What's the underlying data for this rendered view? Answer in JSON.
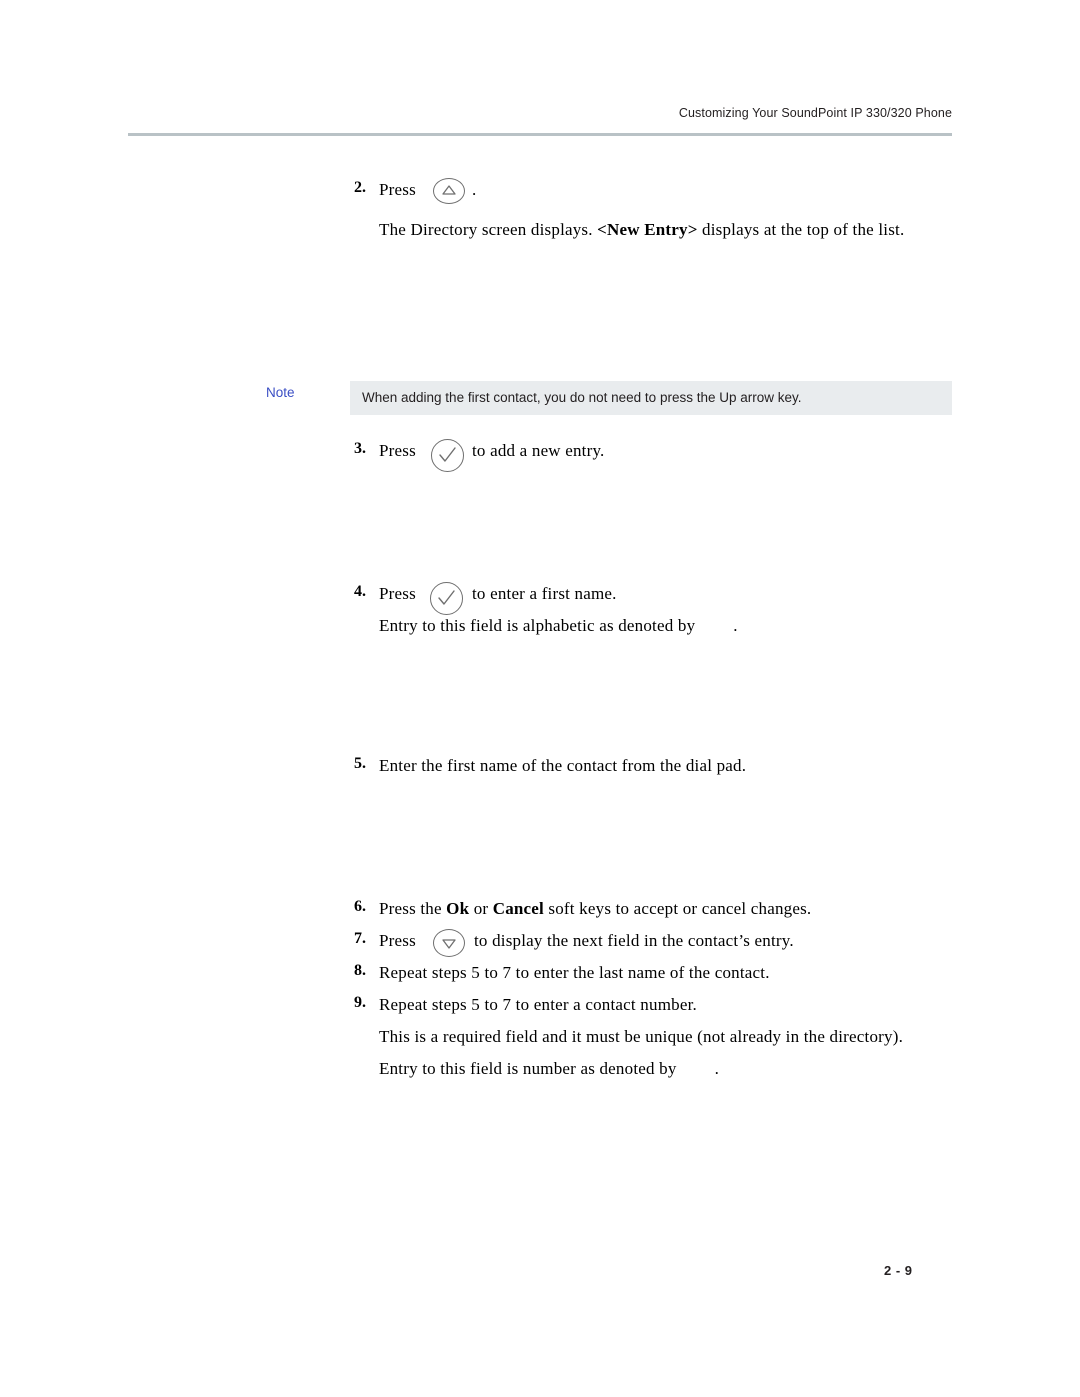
{
  "header": {
    "running_title": "Customizing Your SoundPoint IP 330/320 Phone"
  },
  "note": {
    "label": "Note",
    "text": "When adding the first contact, you do not need to press the Up arrow key."
  },
  "steps": {
    "s2_num": "2.",
    "s2_press": "Press",
    "s2_period": ".",
    "s2_result_a": "The Directory screen displays. ",
    "s2_result_b": "<New Entry>",
    "s2_result_c": " displays at the top of the list.",
    "s3_num": "3.",
    "s3_press": "Press",
    "s3_text": "to add a new entry.",
    "s4_num": "4.",
    "s4_press": "Press",
    "s4_text": "to enter a first name.",
    "s4_sub_a": "Entry to this field is alphabetic as denoted by",
    "s4_sub_b": ".",
    "s5_num": "5.",
    "s5_text": "Enter the first name of the contact from the dial pad.",
    "s6_num": "6.",
    "s6_a": "Press the ",
    "s6_ok": "Ok",
    "s6_b": " or ",
    "s6_cancel": "Cancel",
    "s6_c": " soft keys to accept or cancel changes.",
    "s7_num": "7.",
    "s7_press": "Press",
    "s7_text": "to display the next field in the contact’s entry.",
    "s8_num": "8.",
    "s8_text": "Repeat steps 5 to 7 to enter the last name of the contact.",
    "s9_num": "9.",
    "s9_text": "Repeat steps 5 to 7 to enter a contact number.",
    "s9_sub1": "This is a required field and it must be unique (not already in the directory).",
    "s9_sub2_a": "Entry to this field is number as denoted by",
    "s9_sub2_b": "."
  },
  "footer": {
    "page_number": "2 - 9"
  },
  "icons": {
    "up_arrow": "up-arrow-key-icon",
    "check": "check-key-icon",
    "down_arrow": "down-arrow-key-icon"
  },
  "colors": {
    "rule": "#b9c2c6",
    "note_bg": "#e9ecee",
    "note_label": "#3a4ec4",
    "key_outline": "#6f6f6f"
  }
}
